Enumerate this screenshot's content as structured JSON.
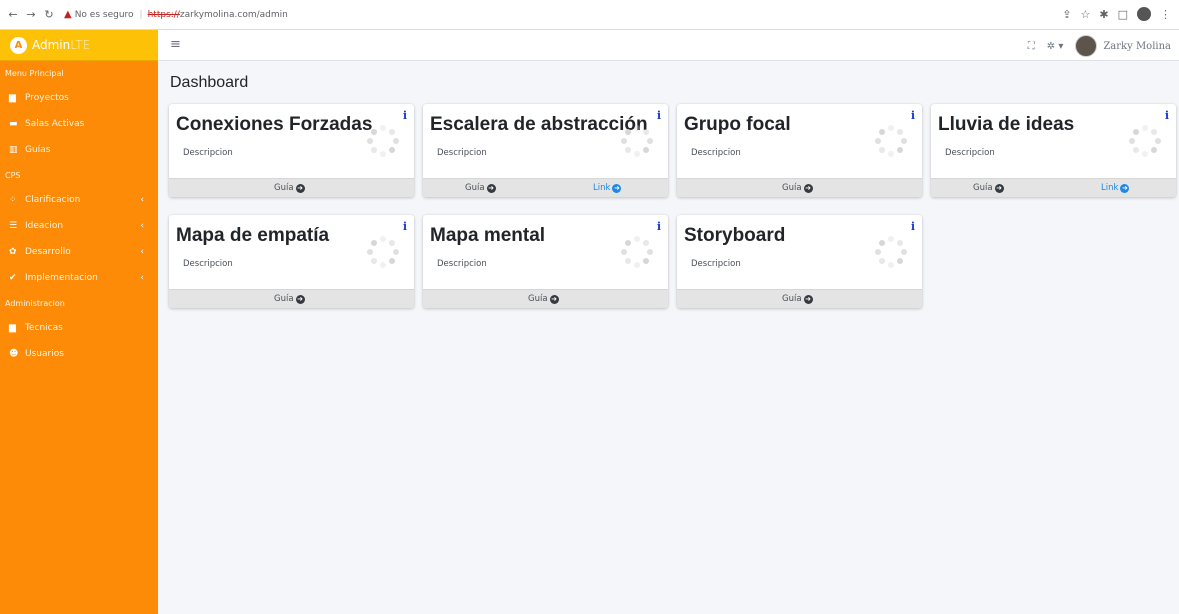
{
  "browser": {
    "insecure_label": "No es seguro",
    "url_scheme": "https://",
    "url_rest": "zarkymolina.com/admin"
  },
  "brand": {
    "logo_letter": "A",
    "name_bold": "Admin",
    "name_light": "LTE"
  },
  "sidebar": {
    "menu_header": "Menu Principal",
    "items_main": [
      {
        "label": "Proyectos",
        "icon": "folder-icon"
      },
      {
        "label": "Salas Activas",
        "icon": "vr-icon"
      },
      {
        "label": "Guías",
        "icon": "map-icon"
      }
    ],
    "cps_header": "CPS",
    "items_cps": [
      {
        "label": "Clarificacion",
        "icon": "spinner-icon"
      },
      {
        "label": "Ideacion",
        "icon": "list-icon"
      },
      {
        "label": "Desarrollo",
        "icon": "gear-icon"
      },
      {
        "label": "Implementacion",
        "icon": "check-icon"
      }
    ],
    "admin_header": "Administracion",
    "items_admin": [
      {
        "label": "Tecnicas",
        "icon": "folder-icon"
      },
      {
        "label": "Usuarios",
        "icon": "users-icon"
      }
    ]
  },
  "navbar": {
    "user_name": "Zarky Molina"
  },
  "page": {
    "title": "Dashboard"
  },
  "cards": [
    {
      "title": "Conexiones Forzadas",
      "desc": "Descripcion",
      "guide": "Guía",
      "link": ""
    },
    {
      "title": "Escalera de abstracción",
      "desc": "Descripcion",
      "guide": "Guía",
      "link": "Link"
    },
    {
      "title": "Grupo focal",
      "desc": "Descripcion",
      "guide": "Guía",
      "link": ""
    },
    {
      "title": "Lluvia de ideas",
      "desc": "Descripcion",
      "guide": "Guía",
      "link": "Link"
    },
    {
      "title": "Mapa de empatía",
      "desc": "Descripcion",
      "guide": "Guía",
      "link": ""
    },
    {
      "title": "Mapa mental",
      "desc": "Descripcion",
      "guide": "Guía",
      "link": ""
    },
    {
      "title": "Storyboard",
      "desc": "Descripcion",
      "guide": "Guía",
      "link": ""
    }
  ],
  "card_info_glyph": "i",
  "colors": {
    "sidebar": "#fd8b07",
    "brand": "#fdc107",
    "info": "#1a3bd6",
    "link": "#1e88e5"
  }
}
